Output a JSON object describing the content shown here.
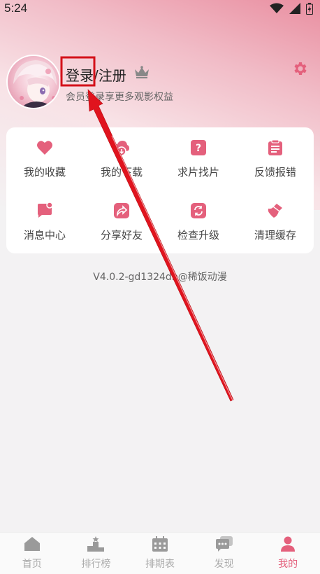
{
  "status_bar": {
    "time": "5:24"
  },
  "profile": {
    "title": "登录/注册",
    "subtitle": "会员登录享更多观影权益"
  },
  "grid": [
    {
      "label": "我的收藏",
      "icon": "heart-icon"
    },
    {
      "label": "我的下载",
      "icon": "download-icon"
    },
    {
      "label": "求片找片",
      "icon": "question-icon"
    },
    {
      "label": "反馈报错",
      "icon": "clipboard-icon"
    },
    {
      "label": "消息中心",
      "icon": "message-icon"
    },
    {
      "label": "分享好友",
      "icon": "share-icon"
    },
    {
      "label": "检查升级",
      "icon": "refresh-icon"
    },
    {
      "label": "清理缓存",
      "icon": "broom-icon"
    }
  ],
  "version": "V4.0.2-gd1324db@稀饭动漫",
  "tabs": [
    {
      "label": "首页",
      "icon": "home-icon"
    },
    {
      "label": "排行榜",
      "icon": "ranking-icon"
    },
    {
      "label": "排期表",
      "icon": "calendar-icon"
    },
    {
      "label": "发现",
      "icon": "discover-icon"
    },
    {
      "label": "我的",
      "icon": "profile-icon"
    }
  ],
  "colors": {
    "accent": "#e4607c",
    "annotation": "#e0141e"
  }
}
